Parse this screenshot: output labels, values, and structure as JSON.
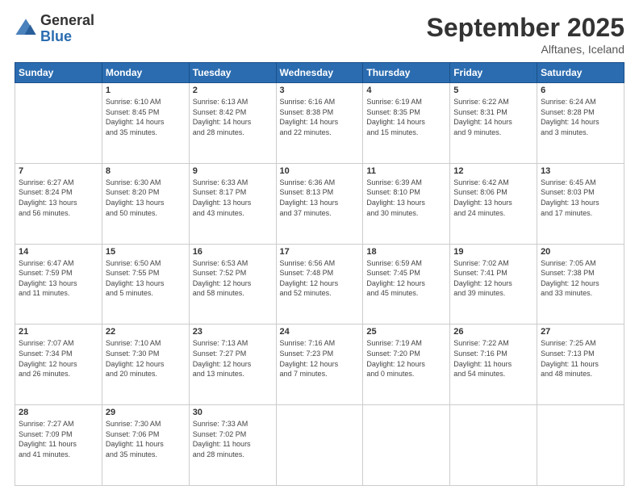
{
  "logo": {
    "general": "General",
    "blue": "Blue"
  },
  "title": "September 2025",
  "location": "Alftanes, Iceland",
  "days_header": [
    "Sunday",
    "Monday",
    "Tuesday",
    "Wednesday",
    "Thursday",
    "Friday",
    "Saturday"
  ],
  "weeks": [
    [
      {
        "day": "",
        "info": ""
      },
      {
        "day": "1",
        "info": "Sunrise: 6:10 AM\nSunset: 8:45 PM\nDaylight: 14 hours\nand 35 minutes."
      },
      {
        "day": "2",
        "info": "Sunrise: 6:13 AM\nSunset: 8:42 PM\nDaylight: 14 hours\nand 28 minutes."
      },
      {
        "day": "3",
        "info": "Sunrise: 6:16 AM\nSunset: 8:38 PM\nDaylight: 14 hours\nand 22 minutes."
      },
      {
        "day": "4",
        "info": "Sunrise: 6:19 AM\nSunset: 8:35 PM\nDaylight: 14 hours\nand 15 minutes."
      },
      {
        "day": "5",
        "info": "Sunrise: 6:22 AM\nSunset: 8:31 PM\nDaylight: 14 hours\nand 9 minutes."
      },
      {
        "day": "6",
        "info": "Sunrise: 6:24 AM\nSunset: 8:28 PM\nDaylight: 14 hours\nand 3 minutes."
      }
    ],
    [
      {
        "day": "7",
        "info": "Sunrise: 6:27 AM\nSunset: 8:24 PM\nDaylight: 13 hours\nand 56 minutes."
      },
      {
        "day": "8",
        "info": "Sunrise: 6:30 AM\nSunset: 8:20 PM\nDaylight: 13 hours\nand 50 minutes."
      },
      {
        "day": "9",
        "info": "Sunrise: 6:33 AM\nSunset: 8:17 PM\nDaylight: 13 hours\nand 43 minutes."
      },
      {
        "day": "10",
        "info": "Sunrise: 6:36 AM\nSunset: 8:13 PM\nDaylight: 13 hours\nand 37 minutes."
      },
      {
        "day": "11",
        "info": "Sunrise: 6:39 AM\nSunset: 8:10 PM\nDaylight: 13 hours\nand 30 minutes."
      },
      {
        "day": "12",
        "info": "Sunrise: 6:42 AM\nSunset: 8:06 PM\nDaylight: 13 hours\nand 24 minutes."
      },
      {
        "day": "13",
        "info": "Sunrise: 6:45 AM\nSunset: 8:03 PM\nDaylight: 13 hours\nand 17 minutes."
      }
    ],
    [
      {
        "day": "14",
        "info": "Sunrise: 6:47 AM\nSunset: 7:59 PM\nDaylight: 13 hours\nand 11 minutes."
      },
      {
        "day": "15",
        "info": "Sunrise: 6:50 AM\nSunset: 7:55 PM\nDaylight: 13 hours\nand 5 minutes."
      },
      {
        "day": "16",
        "info": "Sunrise: 6:53 AM\nSunset: 7:52 PM\nDaylight: 12 hours\nand 58 minutes."
      },
      {
        "day": "17",
        "info": "Sunrise: 6:56 AM\nSunset: 7:48 PM\nDaylight: 12 hours\nand 52 minutes."
      },
      {
        "day": "18",
        "info": "Sunrise: 6:59 AM\nSunset: 7:45 PM\nDaylight: 12 hours\nand 45 minutes."
      },
      {
        "day": "19",
        "info": "Sunrise: 7:02 AM\nSunset: 7:41 PM\nDaylight: 12 hours\nand 39 minutes."
      },
      {
        "day": "20",
        "info": "Sunrise: 7:05 AM\nSunset: 7:38 PM\nDaylight: 12 hours\nand 33 minutes."
      }
    ],
    [
      {
        "day": "21",
        "info": "Sunrise: 7:07 AM\nSunset: 7:34 PM\nDaylight: 12 hours\nand 26 minutes."
      },
      {
        "day": "22",
        "info": "Sunrise: 7:10 AM\nSunset: 7:30 PM\nDaylight: 12 hours\nand 20 minutes."
      },
      {
        "day": "23",
        "info": "Sunrise: 7:13 AM\nSunset: 7:27 PM\nDaylight: 12 hours\nand 13 minutes."
      },
      {
        "day": "24",
        "info": "Sunrise: 7:16 AM\nSunset: 7:23 PM\nDaylight: 12 hours\nand 7 minutes."
      },
      {
        "day": "25",
        "info": "Sunrise: 7:19 AM\nSunset: 7:20 PM\nDaylight: 12 hours\nand 0 minutes."
      },
      {
        "day": "26",
        "info": "Sunrise: 7:22 AM\nSunset: 7:16 PM\nDaylight: 11 hours\nand 54 minutes."
      },
      {
        "day": "27",
        "info": "Sunrise: 7:25 AM\nSunset: 7:13 PM\nDaylight: 11 hours\nand 48 minutes."
      }
    ],
    [
      {
        "day": "28",
        "info": "Sunrise: 7:27 AM\nSunset: 7:09 PM\nDaylight: 11 hours\nand 41 minutes."
      },
      {
        "day": "29",
        "info": "Sunrise: 7:30 AM\nSunset: 7:06 PM\nDaylight: 11 hours\nand 35 minutes."
      },
      {
        "day": "30",
        "info": "Sunrise: 7:33 AM\nSunset: 7:02 PM\nDaylight: 11 hours\nand 28 minutes."
      },
      {
        "day": "",
        "info": ""
      },
      {
        "day": "",
        "info": ""
      },
      {
        "day": "",
        "info": ""
      },
      {
        "day": "",
        "info": ""
      }
    ]
  ]
}
